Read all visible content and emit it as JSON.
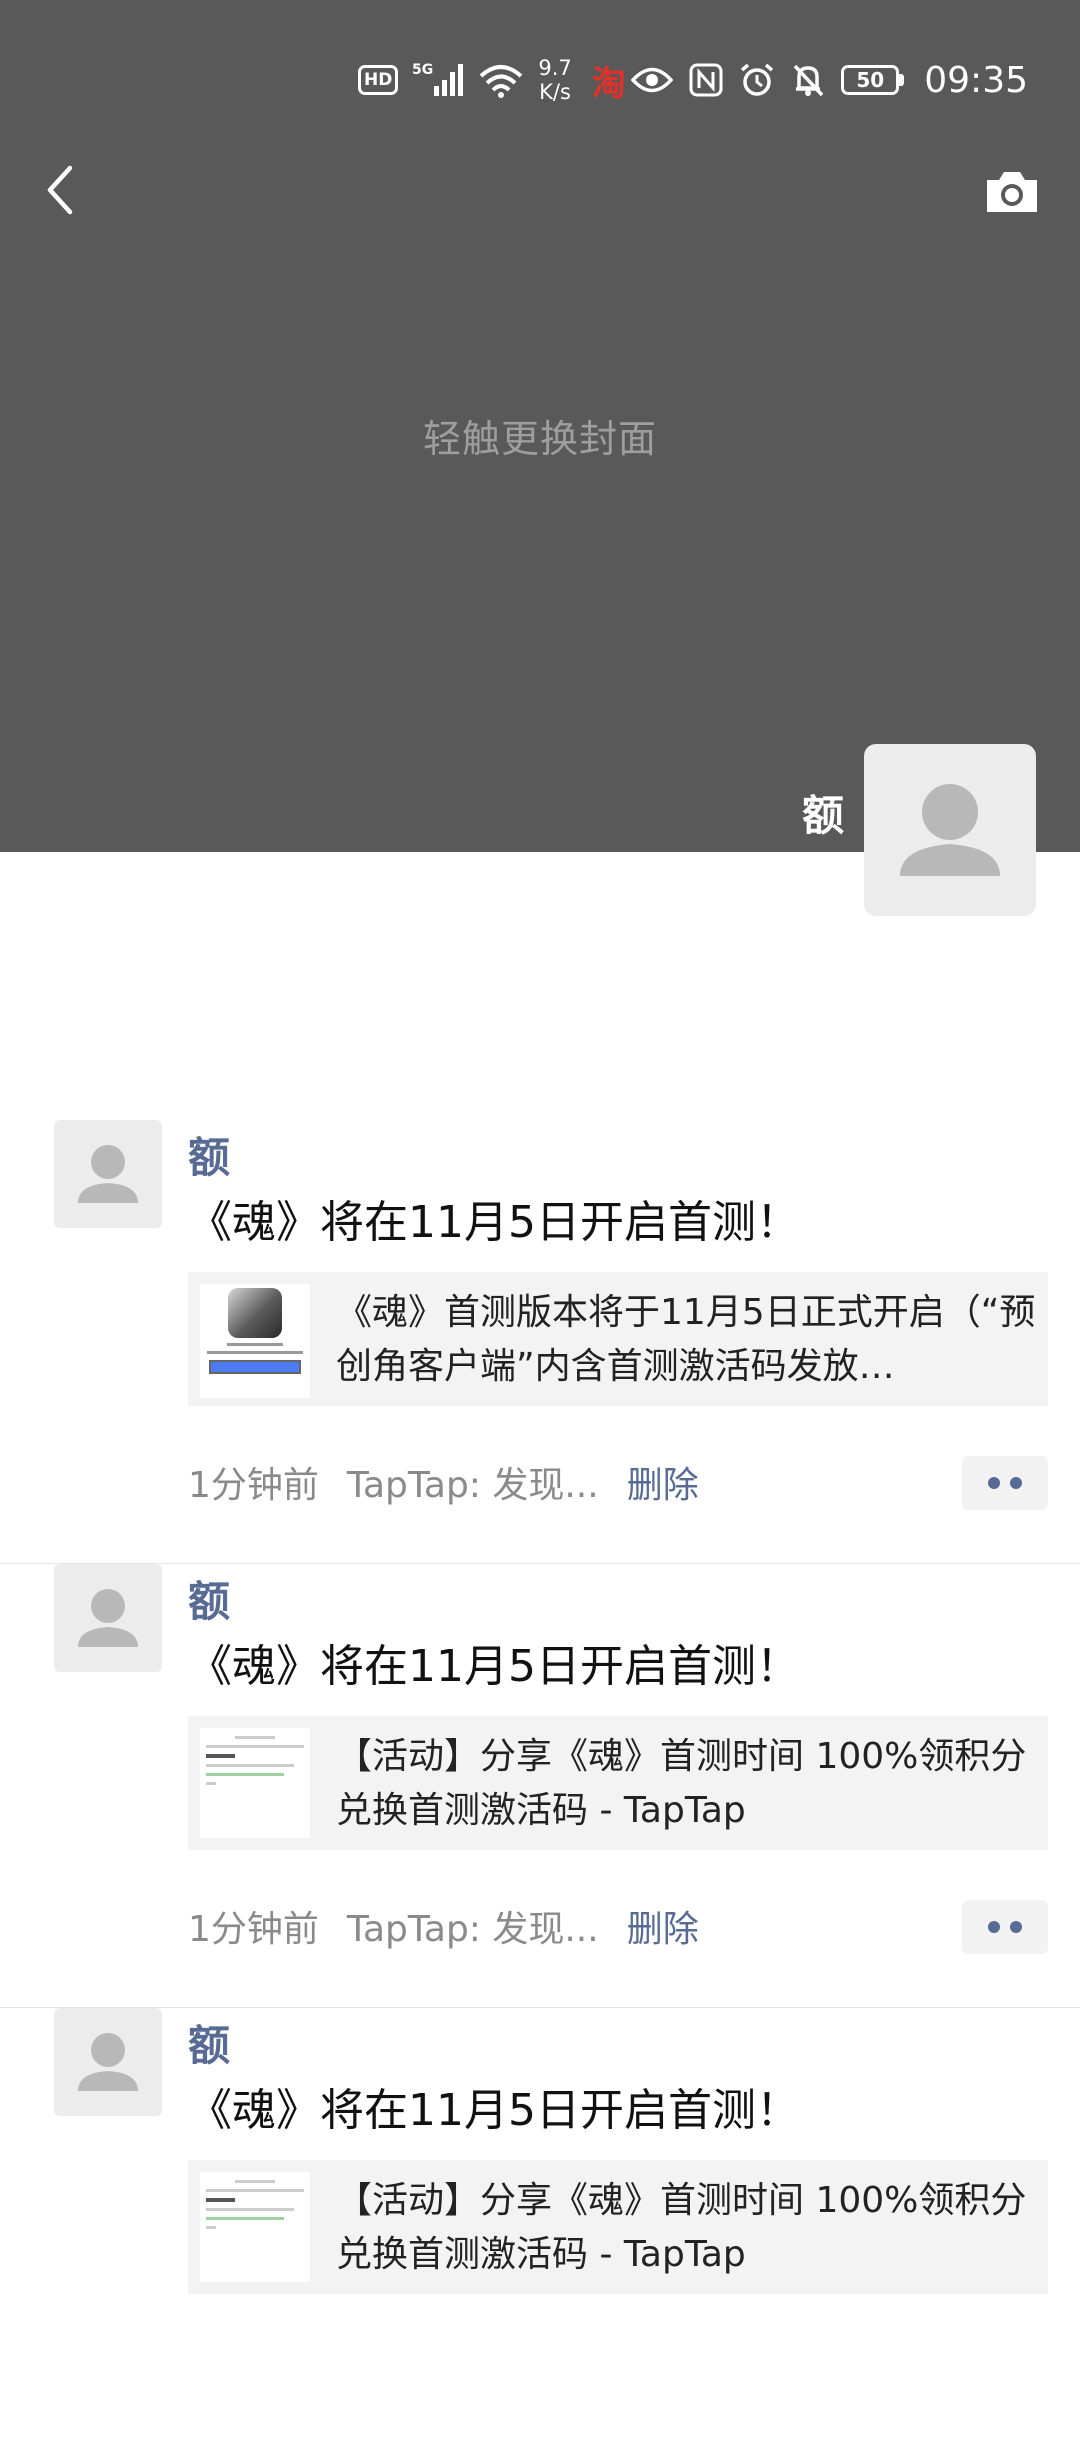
{
  "status_bar": {
    "hd": "HD",
    "signal": "5G",
    "speed_value": "9.7",
    "speed_unit": "K/s",
    "taobao": "淘",
    "battery": "50",
    "time": "09:35"
  },
  "header": {
    "back_icon": "chevron-left-icon",
    "camera_icon": "camera-icon"
  },
  "cover": {
    "hint": "轻触更换封面"
  },
  "profile": {
    "name": "额"
  },
  "posts": [
    {
      "author": "额",
      "text": "《魂》将在11月5日开启首测！",
      "link_title": "《魂》首测版本将于11月5日正式开启（“预创角客户端”内含首测激活码发放…",
      "time": "1分钟前",
      "source": "TapTap: 发现...",
      "delete": "删除",
      "thumb_type": "game"
    },
    {
      "author": "额",
      "text": "《魂》将在11月5日开启首测！",
      "link_title": "【活动】分享《魂》首测时间 100%领积分兑换首测激活码 - TapTap",
      "time": "1分钟前",
      "source": "TapTap: 发现...",
      "delete": "删除",
      "thumb_type": "doc"
    },
    {
      "author": "额",
      "text": "《魂》将在11月5日开启首测！",
      "link_title": "【活动】分享《魂》首测时间 100%领积分兑换首测激活码 - TapTap",
      "thumb_type": "doc"
    }
  ]
}
